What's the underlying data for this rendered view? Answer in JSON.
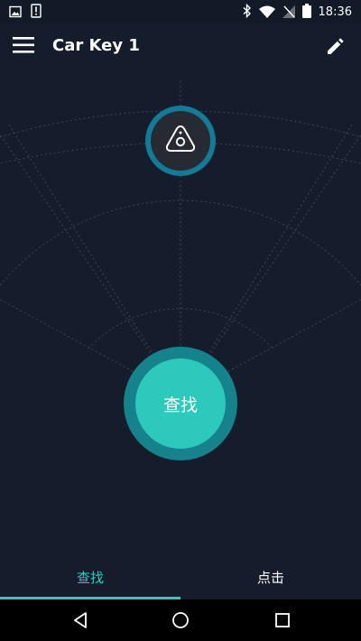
{
  "status_bar": {
    "time": "18:36",
    "icons_left": [
      "image-notification-icon",
      "alert-notification-icon"
    ],
    "icons_right": [
      "bluetooth-icon",
      "wifi-icon",
      "no-sim-icon",
      "battery-icon"
    ]
  },
  "app_bar": {
    "title": "Car Key 1",
    "menu_icon": "hamburger-menu-icon",
    "edit_icon": "pencil-icon"
  },
  "radar": {
    "device_icon": "key-tag-icon"
  },
  "find_button": {
    "label": "查找"
  },
  "tabs": [
    {
      "label": "查找",
      "active": true
    },
    {
      "label": "点击",
      "active": false
    }
  ],
  "nav_bar": {
    "icons": [
      "back-icon",
      "home-icon",
      "recents-icon"
    ]
  },
  "colors": {
    "background": "#151d2c",
    "accent": "#2ec9bd",
    "accent_dark": "#16828c",
    "device_ring": "#147a96"
  }
}
